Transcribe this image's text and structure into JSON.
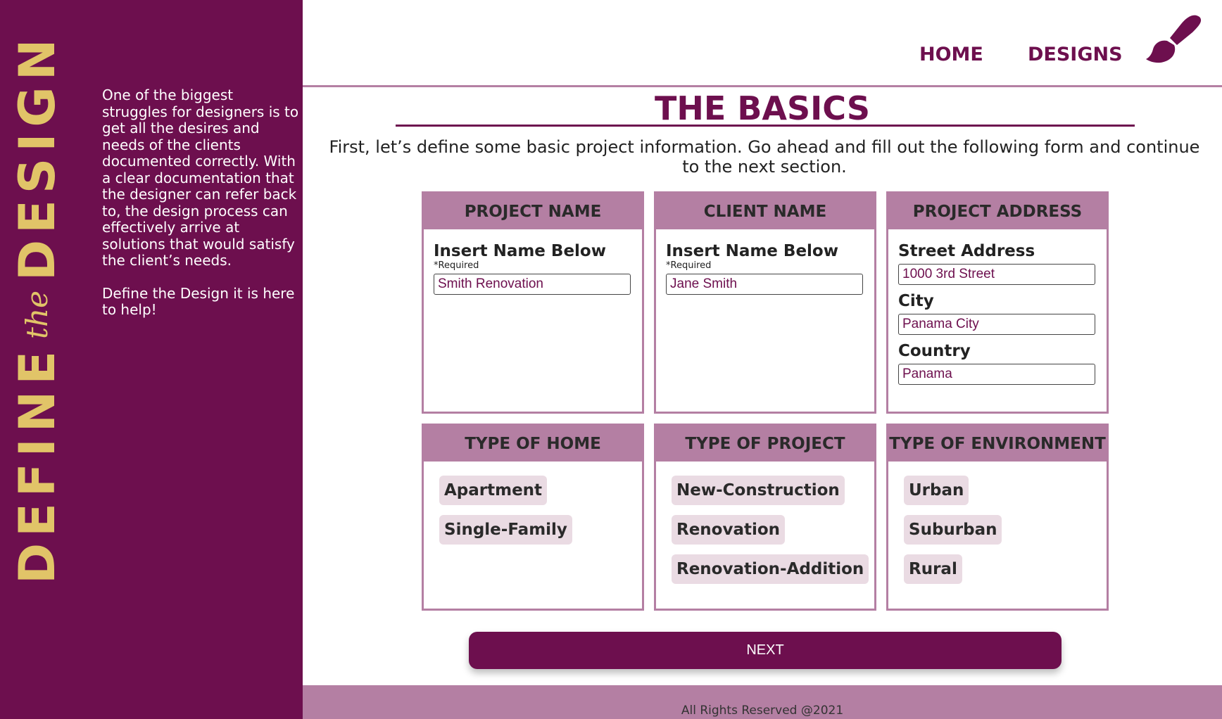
{
  "brand": {
    "word1": "DEFINE",
    "word2": "the",
    "word3": "DESIGN"
  },
  "sidebar": {
    "paragraph1": "One of the biggest struggles for designers is to get all the desires and needs of the clients documented correctly. With a clear documentation that the designer can refer back to, the design process can effectively arrive at solutions that would satisfy the client’s needs.",
    "paragraph2": "Define the Design it is here to help!"
  },
  "nav": {
    "home": "HOME",
    "designs": "DESIGNS",
    "logo_icon": "paintbrush-icon"
  },
  "main": {
    "title": "THE BASICS",
    "intro": "First, let’s define some basic project information. Go ahead and fill out the following form and continue to the next section."
  },
  "cards": {
    "project_name": {
      "title": "PROJECT NAME",
      "label": "Insert Name Below",
      "required": "*Required",
      "value": "Smith Renovation"
    },
    "client_name": {
      "title": "CLIENT NAME",
      "label": "Insert Name Below",
      "required": "*Required",
      "value": "Jane Smith"
    },
    "project_address": {
      "title": "PROJECT ADDRESS",
      "street_label": "Street Address",
      "street_value": "1000 3rd Street",
      "city_label": "City",
      "city_value": "Panama City",
      "country_label": "Country",
      "country_value": "Panama"
    },
    "type_of_home": {
      "title": "TYPE OF HOME",
      "options": [
        "Apartment",
        "Single-Family"
      ]
    },
    "type_of_project": {
      "title": "TYPE OF PROJECT",
      "options": [
        "New-Construction",
        "Renovation",
        "Renovation-Addition"
      ]
    },
    "type_of_environment": {
      "title": "TYPE OF ENVIRONMENT",
      "options": [
        "Urban",
        "Suburban",
        "Rural"
      ]
    }
  },
  "next_label": "NEXT",
  "footer": "All Rights Reserved @2021",
  "colors": {
    "primary": "#6d0f4e",
    "accent": "#b47fa3",
    "brand_gold": "#e1c468",
    "chip": "#eadbe3"
  }
}
